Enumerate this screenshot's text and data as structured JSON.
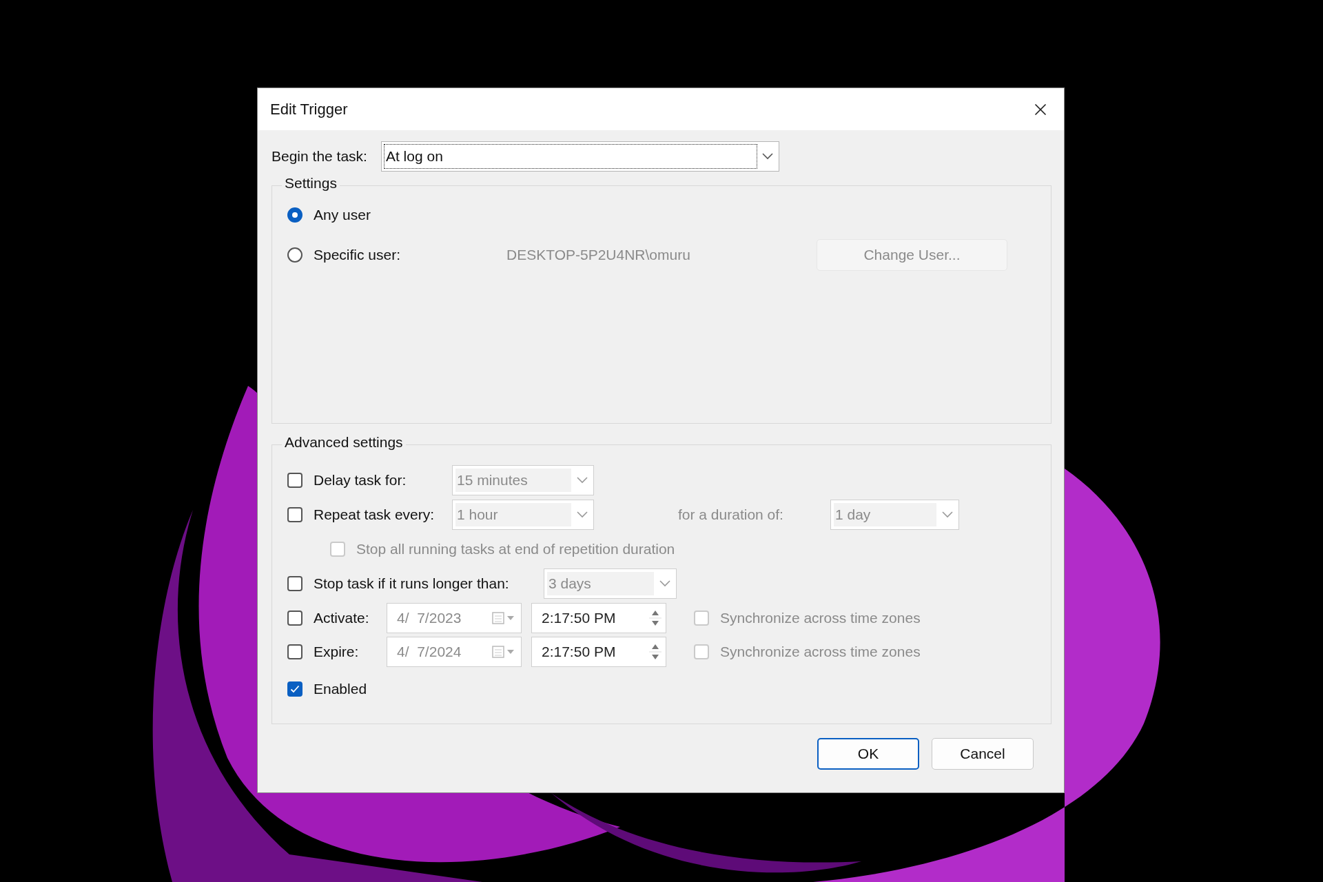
{
  "window": {
    "title": "Edit Trigger"
  },
  "begin_task": {
    "label": "Begin the task:",
    "value": "At log on"
  },
  "settings": {
    "title": "Settings",
    "options": [
      {
        "label": "Any user",
        "selected": true
      },
      {
        "label": "Specific user:",
        "selected": false
      }
    ],
    "user": "DESKTOP-5P2U4NR\\omuru",
    "change_user": {
      "label": "Change User...",
      "disabled": true
    }
  },
  "advanced": {
    "title": "Advanced settings",
    "delay": {
      "label": "Delay task for:",
      "checked": false,
      "value": "15 minutes",
      "disabled": true
    },
    "repeat": {
      "label": "Repeat task every:",
      "checked": false,
      "value": "1 hour",
      "disabled": true,
      "duration_label": "for a duration of:",
      "duration_value": "1 day"
    },
    "stop_all": {
      "label": "Stop all running tasks at end of repetition duration",
      "checked": false,
      "disabled": true
    },
    "stop_longer": {
      "label": "Stop task if it runs longer than:",
      "checked": false,
      "value": "3 days",
      "disabled": true
    },
    "dates": [
      {
        "label": "Activate:",
        "checked": false,
        "date": "4/  7/2023",
        "time": "2:17:50 PM",
        "sync": {
          "label": "Synchronize across time zones",
          "checked": false,
          "disabled": true
        }
      },
      {
        "label": "Expire:",
        "checked": false,
        "date": "4/  7/2024",
        "time": "2:17:50 PM",
        "sync": {
          "label": "Synchronize across time zones",
          "checked": false,
          "disabled": true
        }
      }
    ],
    "enabled": {
      "label": "Enabled",
      "checked": true
    }
  },
  "buttons": [
    {
      "label": "OK",
      "default": true
    },
    {
      "label": "Cancel",
      "default": false
    }
  ]
}
